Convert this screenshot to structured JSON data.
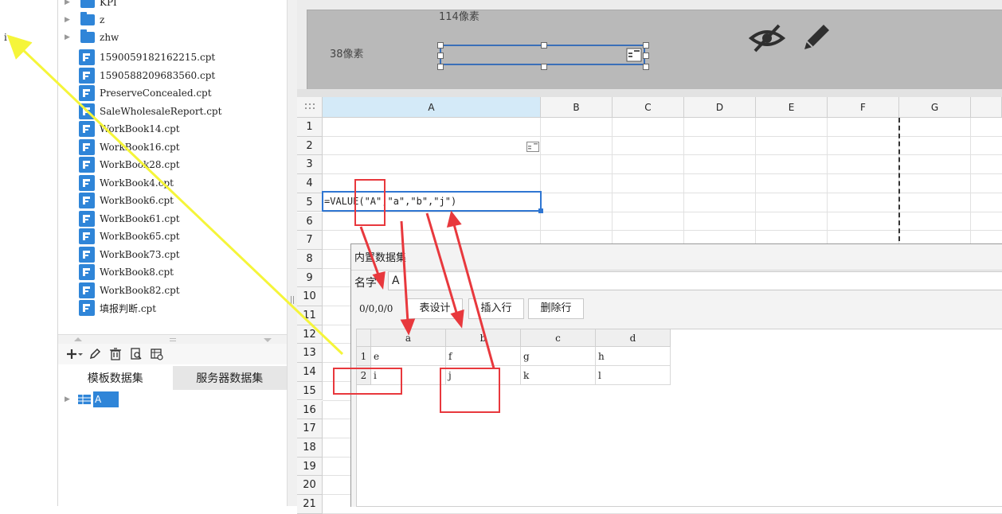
{
  "left_cell_text": "i",
  "file_tree": {
    "folders": [
      "KPI",
      "z",
      "zhw"
    ],
    "files": [
      "1590059182162215.cpt",
      "1590588209683560.cpt",
      "PreserveConcealed.cpt",
      "SaleWholesaleReport.cpt",
      "WorkBook14.cpt",
      "WorkBook16.cpt",
      "WorkBook28.cpt",
      "WorkBook4.cpt",
      "WorkBook6.cpt",
      "WorkBook61.cpt",
      "WorkBook65.cpt",
      "WorkBook73.cpt",
      "WorkBook8.cpt",
      "WorkBook82.cpt",
      "填报判断.cpt"
    ]
  },
  "dataset_panel": {
    "tabs": [
      "模板数据集",
      "服务器数据集"
    ],
    "items": [
      "A"
    ]
  },
  "preview": {
    "width_label": "114像素",
    "height_label": "38像素"
  },
  "sheet": {
    "columns": [
      "A",
      "B",
      "C",
      "D",
      "E",
      "F",
      "G"
    ],
    "rows": [
      "1",
      "2",
      "3",
      "4",
      "5",
      "6",
      "7",
      "8",
      "9",
      "10",
      "11",
      "12",
      "13",
      "14",
      "15",
      "16",
      "17",
      "18",
      "19",
      "20",
      "21"
    ],
    "a5_formula": "=VALUE(\"A\",\"a\",\"b\",\"j\")"
  },
  "dialog": {
    "title": "内置数据集",
    "name_label": "名字",
    "name_value": "A",
    "position": "0/0,0/0",
    "buttons": [
      "表设计",
      "插入行",
      "删除行"
    ],
    "table": {
      "columns": [
        "a",
        "b",
        "c",
        "d"
      ],
      "rows": [
        {
          "index": "1",
          "cells": [
            "e",
            "f",
            "g",
            "h"
          ]
        },
        {
          "index": "2",
          "cells": [
            "i",
            "j",
            "k",
            "l"
          ]
        }
      ]
    }
  },
  "colors": {
    "accent": "#2f85d8",
    "selection": "#2f76d2",
    "annotation_red": "#e8383d",
    "annotation_yellow": "#f5f53a"
  }
}
